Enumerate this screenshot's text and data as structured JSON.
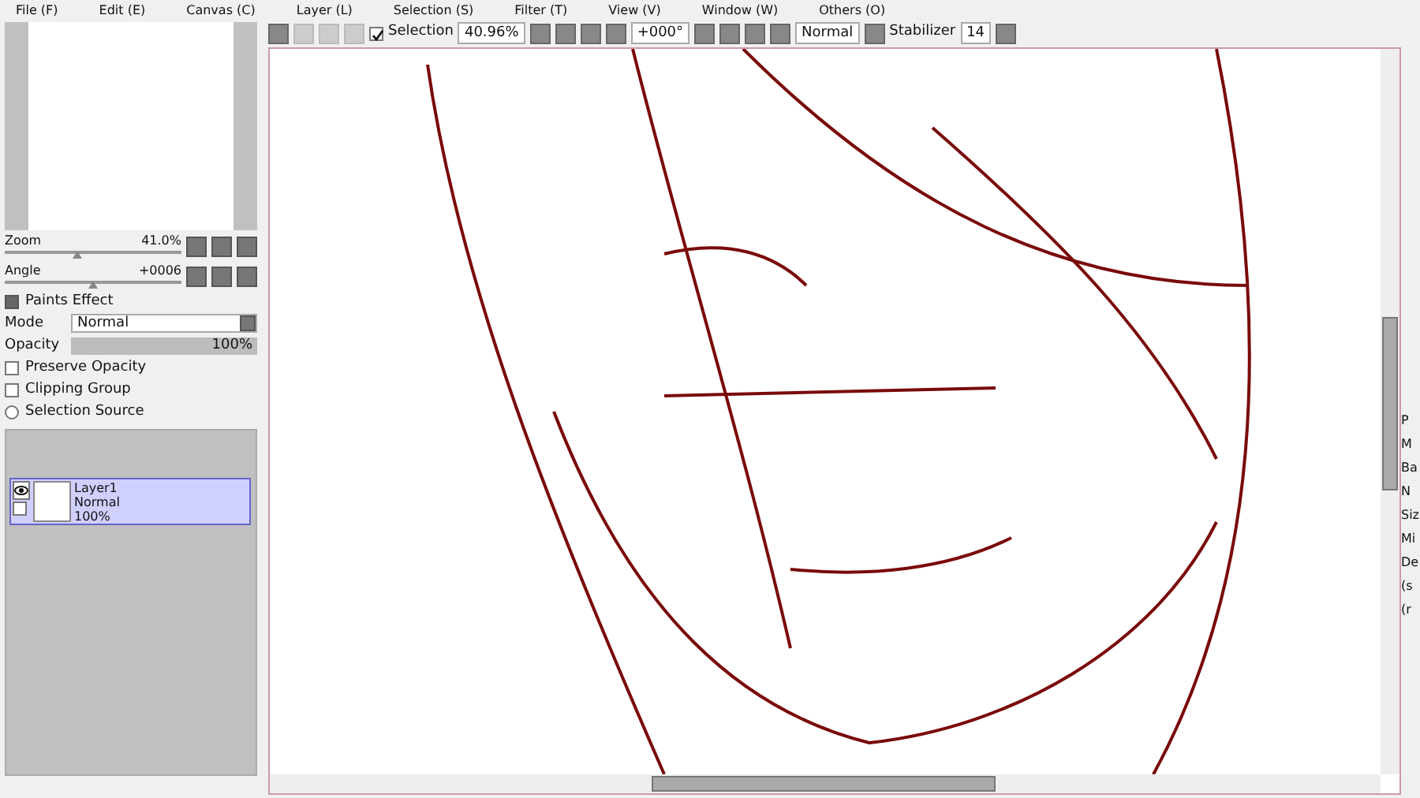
{
  "menu": [
    "File (F)",
    "Edit (E)",
    "Canvas (C)",
    "Layer (L)",
    "Selection (S)",
    "Filter (T)",
    "View (V)",
    "Window (W)",
    "Others (O)"
  ],
  "navigator": {
    "zoom": {
      "label": "Zoom",
      "value": "41.0%",
      "level": 0.41
    },
    "angle": {
      "label": "Angle",
      "value": "+0006",
      "level": 0.5
    }
  },
  "layer_panel": {
    "paints_effect": "Paints Effect",
    "mode_label": "Mode",
    "mode_value": "Normal",
    "opacity_label": "Opacity",
    "opacity": {
      "value": "100%",
      "level": 1
    },
    "options": [
      {
        "label": "Preserve Opacity",
        "kind": "checkbox",
        "checked": false
      },
      {
        "label": "Clipping Group",
        "kind": "checkbox",
        "checked": false
      },
      {
        "label": "Selection Source",
        "kind": "radio",
        "checked": false
      }
    ],
    "layers": [
      {
        "name": "Layer1",
        "mode": "Normal",
        "opacity": "100%",
        "selected": true,
        "visible": true
      }
    ]
  },
  "toolbar": {
    "selection_label": "Selection",
    "selection_checked": true,
    "zoom": "40.96%",
    "angle": "+000°",
    "blend": "Normal",
    "stabilizer_label": "Stabilizer",
    "stabilizer": "14"
  },
  "right_panel": {
    "labels": [
      "P",
      "M",
      "Ba",
      "N",
      "Siz",
      "Mi",
      "De",
      "(s",
      "(r"
    ]
  }
}
